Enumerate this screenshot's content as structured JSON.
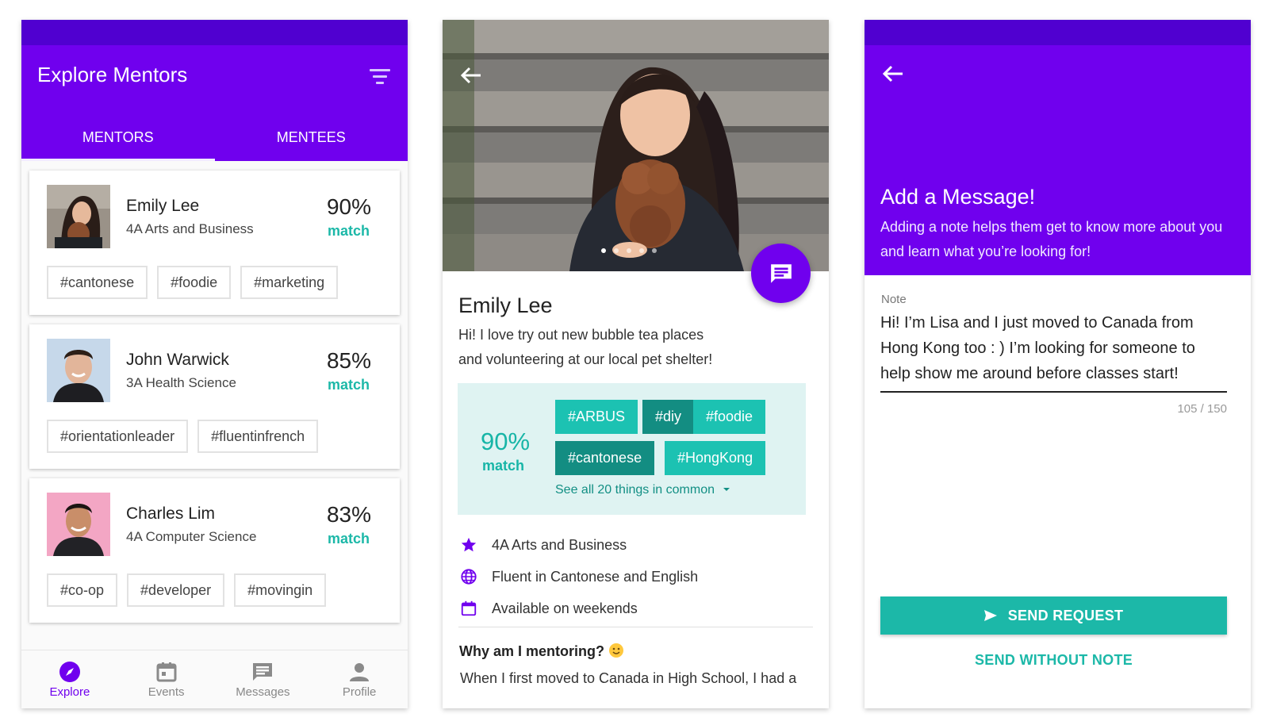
{
  "colors": {
    "primary": "#7000ee",
    "status_bar": "#5000d0",
    "accent": "#1cb8a8",
    "accent_dark": "#128f84",
    "common_bg": "#dff3f2"
  },
  "explore": {
    "title": "Explore Mentors",
    "tabs": [
      {
        "label": "MENTORS",
        "active": true
      },
      {
        "label": "MENTEES",
        "active": false
      }
    ],
    "cards": [
      {
        "name": "Emily Lee",
        "program": "4A Arts and Business",
        "percent": "90%",
        "match_label": "match",
        "tags": [
          "#cantonese",
          "#foodie",
          "#marketing"
        ]
      },
      {
        "name": "John Warwick",
        "program": "3A Health Science",
        "percent": "85%",
        "match_label": "match",
        "tags": [
          "#orientationleader",
          "#fluentinfrench"
        ]
      },
      {
        "name": "Charles Lim",
        "program": "4A Computer Science",
        "percent": "83%",
        "match_label": "match",
        "tags": [
          "#co-op",
          "#developer",
          "#movingin"
        ]
      }
    ],
    "nav": [
      {
        "label": "Explore",
        "icon": "compass-icon",
        "active": true
      },
      {
        "label": "Events",
        "icon": "calendar-icon",
        "active": false
      },
      {
        "label": "Messages",
        "icon": "message-icon",
        "active": false
      },
      {
        "label": "Profile",
        "icon": "person-icon",
        "active": false
      }
    ]
  },
  "profile": {
    "name": "Emily Lee",
    "bio_line1": "Hi! I love try out new bubble tea places",
    "bio_line2": "and volunteering at our local pet shelter!",
    "common": {
      "percent": "90%",
      "match_label": "match",
      "chips": [
        "#ARBUS",
        "#diy",
        "#foodie",
        "#cantonese",
        "#HongKong"
      ],
      "see_all": "See all 20 things in common"
    },
    "facts": [
      {
        "icon": "star-icon",
        "text": "4A Arts and Business"
      },
      {
        "icon": "globe-icon",
        "text": "Fluent in Cantonese and English"
      },
      {
        "icon": "calendar-icon",
        "text": "Available on weekends"
      }
    ],
    "why_heading": "Why am I mentoring?",
    "why_text": "When I first moved to Canada in High School, I had a",
    "photo_pages": 5
  },
  "message": {
    "title": "Add a Message!",
    "subtitle": "Adding a note helps them get to know more about you and learn what you’re looking for!",
    "note_label": "Note",
    "note_text": "Hi! I’m Lisa and I just moved to Canada from Hong Kong too : ) I’m looking for someone to help show me around before classes start!",
    "counter": "105 / 150",
    "send_label": "SEND REQUEST",
    "send_without_label": "SEND WITHOUT NOTE"
  }
}
